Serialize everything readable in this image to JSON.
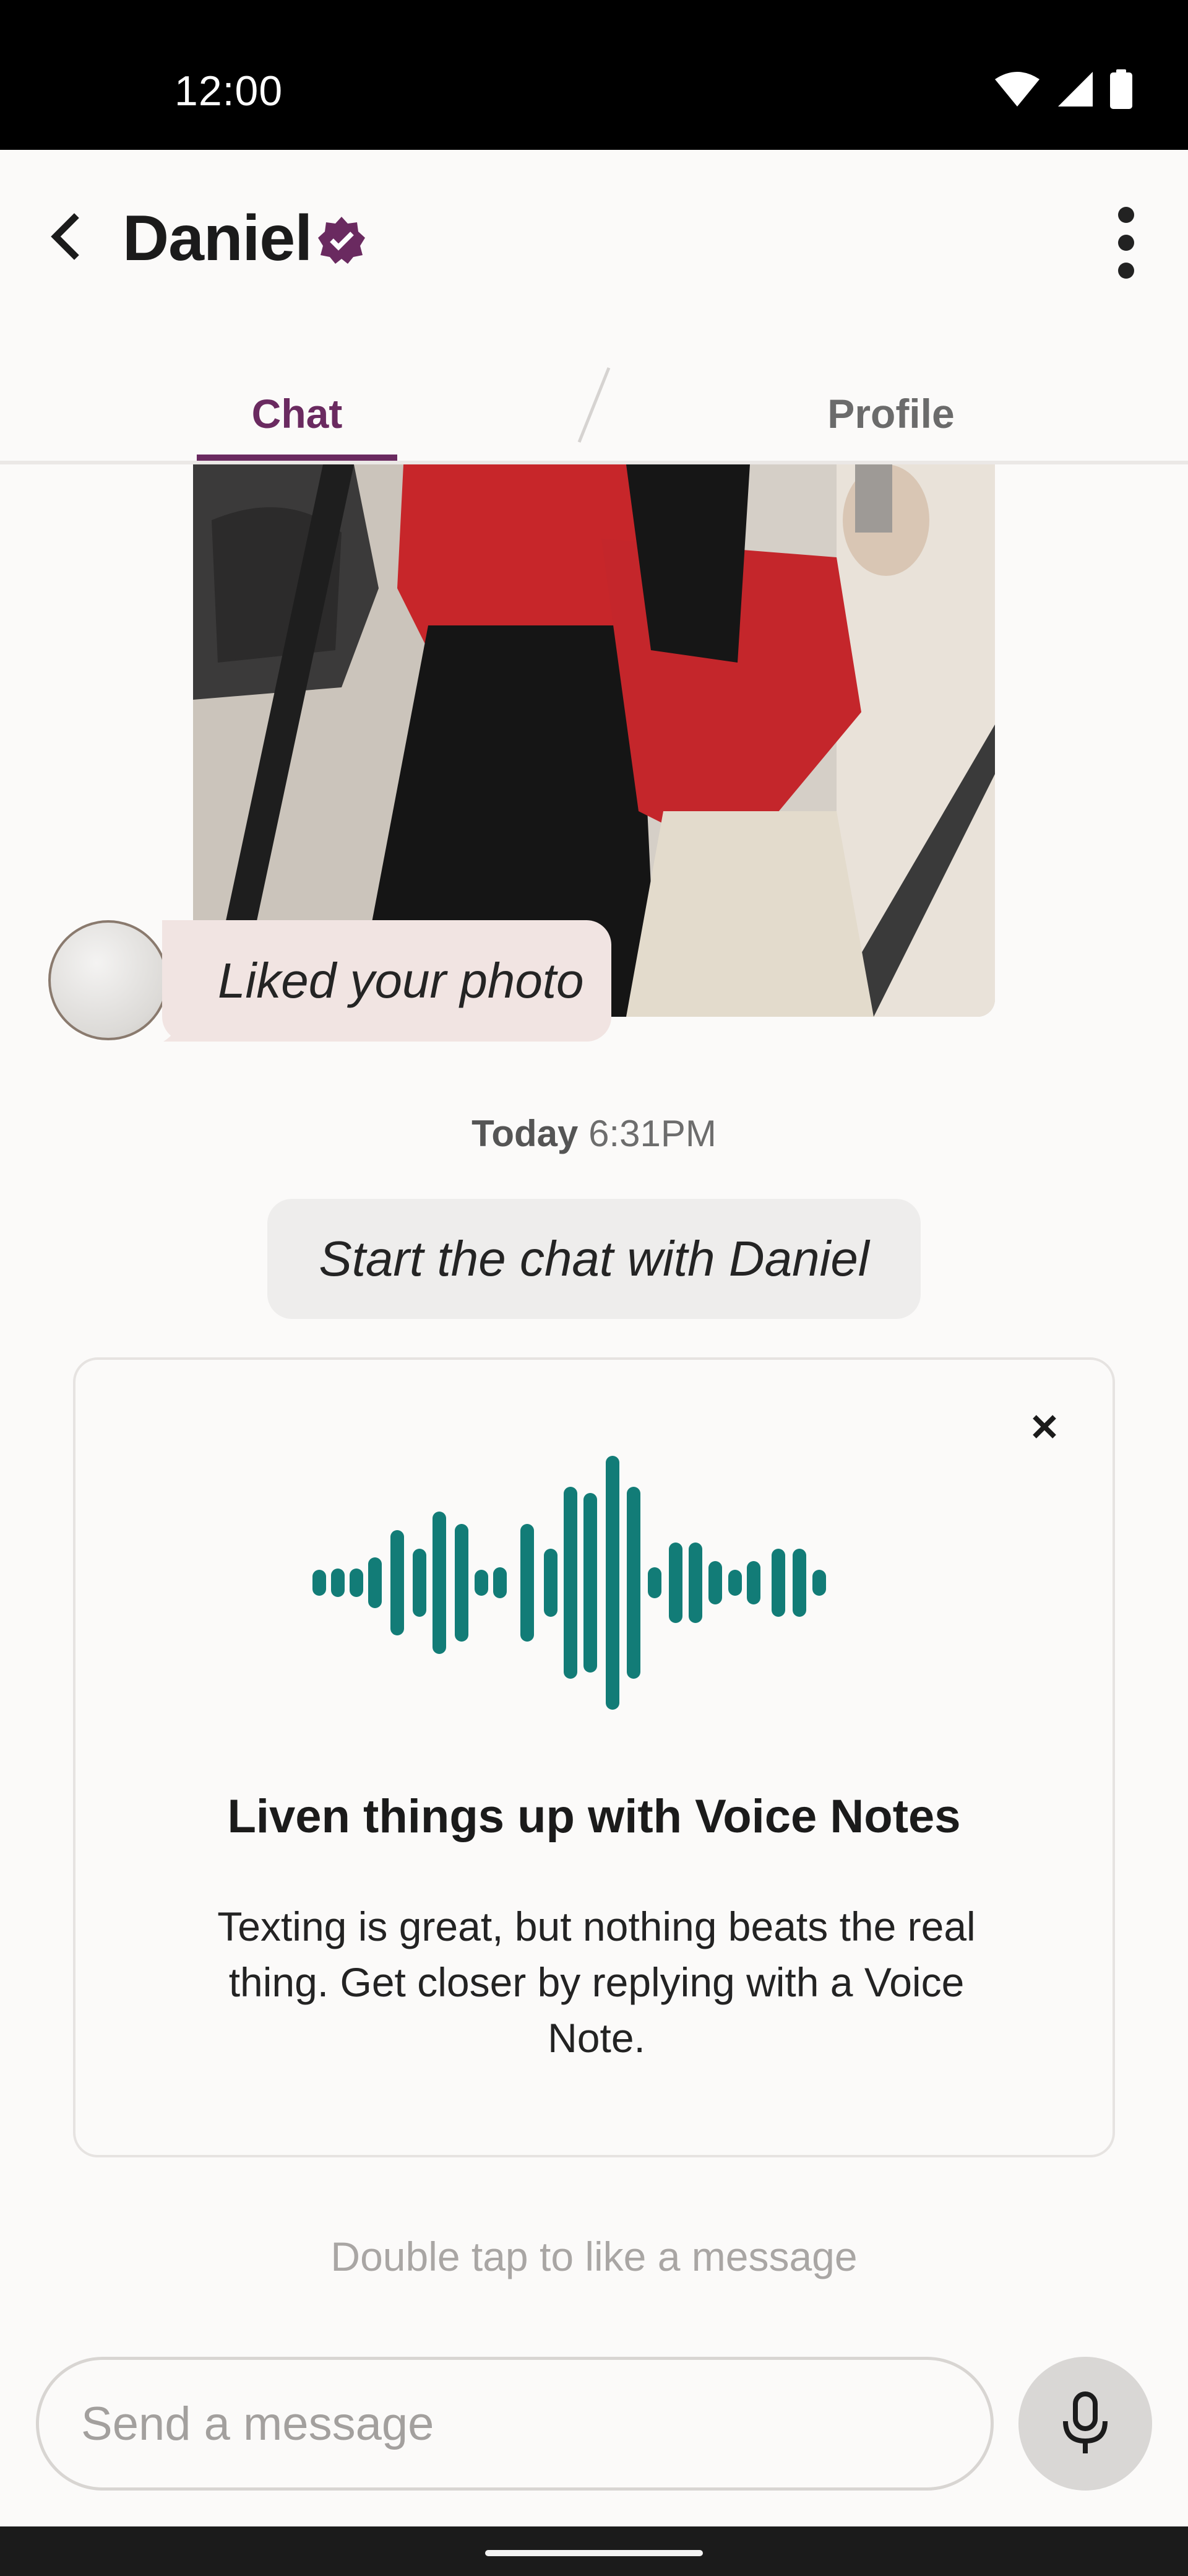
{
  "status_bar": {
    "time": "12:00"
  },
  "header": {
    "name": "Daniel"
  },
  "tabs": {
    "chat": "Chat",
    "profile": "Profile"
  },
  "messages": {
    "liked_photo": "Liked your photo",
    "timestamp_day": "Today",
    "timestamp_time": "6:31PM",
    "start_chat": "Start the chat with Daniel"
  },
  "voice_notes_card": {
    "title": "Liven things up with Voice Notes",
    "body": "Texting is great, but nothing beats the real thing. Get closer by replying with a Voice Note."
  },
  "hint": "Double tap to like a message",
  "composer": {
    "placeholder": "Send a message"
  },
  "colors": {
    "accent": "#6a2a60",
    "waveform": "#127c77",
    "liked_bubble": "#f1e4e2"
  },
  "icons": [
    "back-arrow-icon",
    "verified-badge-icon",
    "more-vert-icon",
    "close-icon",
    "waveform-icon",
    "microphone-icon",
    "wifi-icon",
    "signal-icon",
    "battery-icon"
  ]
}
